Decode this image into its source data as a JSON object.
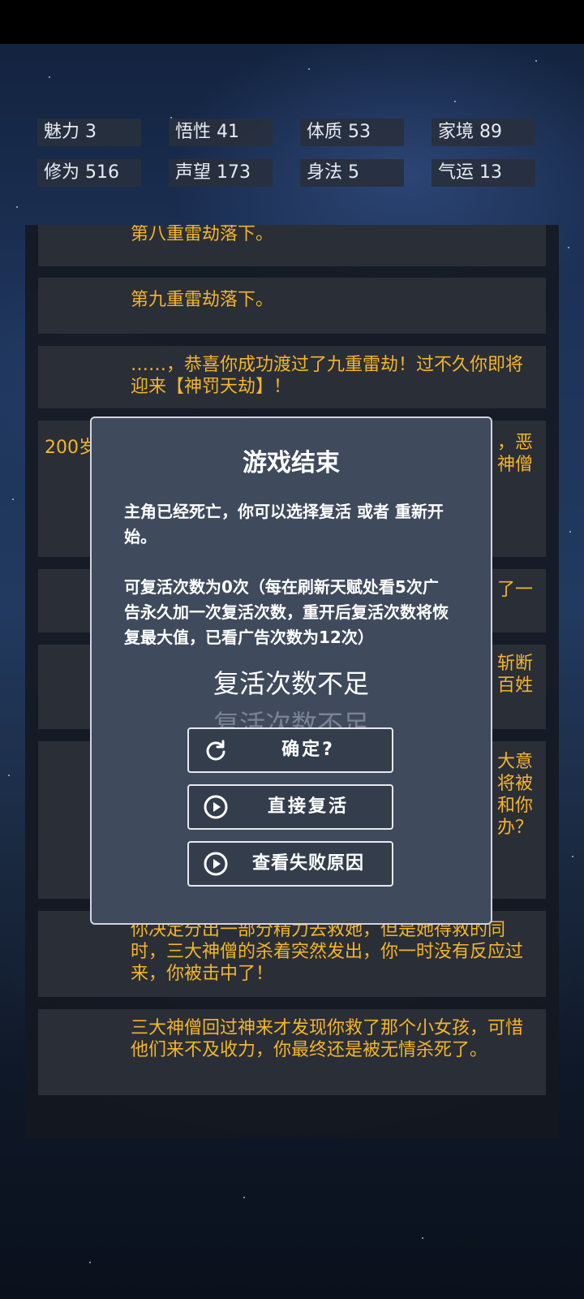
{
  "stats": [
    {
      "label": "魅力 3"
    },
    {
      "label": "悟性 41"
    },
    {
      "label": "体质 53"
    },
    {
      "label": "家境 89"
    },
    {
      "label": "修为 516"
    },
    {
      "label": "声望 173"
    },
    {
      "label": "身法 5"
    },
    {
      "label": "气运 13"
    }
  ],
  "log": {
    "item0": "第八重雷劫落下。",
    "item1": "第九重雷劫落下。",
    "item2": "……，恭喜你成功渡过了九重雷劫！过不久你即将迎来【神罚天劫】！",
    "item3_age": "200岁",
    "item3_right": "，恶\n神僧",
    "item4_right": "了一",
    "item5_right": "斩断\n百姓",
    "item6_right": "大意\n将被\n和你\n办？",
    "item7": "你决定分出一部分精力去救她，但是她得救的同时，三大神僧的杀着突然发出，你一时没有反应过来，你被击中了！",
    "item8": "三大神僧回过神来才发现你救了那个小女孩，可惜他们来不及收力，你最终还是被无情杀死了。"
  },
  "modal": {
    "title": "游戏结束",
    "para1": "主角已经死亡，你可以选择复活 或者 重新开始。",
    "para2": "可复活次数为0次（每在刷新天赋处看5次广告永久加一次复活次数，重开后复活次数将恢复最大值，已看广告次数为12次）",
    "toast": "复活次数不足",
    "toast_ghost": "复活次数不足",
    "buttons": {
      "confirm": "确定?",
      "revive": "直接复活",
      "reason": "查看失败原因"
    }
  },
  "colors": {
    "log_text": "#f4b529",
    "modal_bg": "#3f4a5c"
  },
  "icons": {
    "confirm": "refresh-icon",
    "revive": "play-circle-icon",
    "reason": "play-circle-icon"
  }
}
